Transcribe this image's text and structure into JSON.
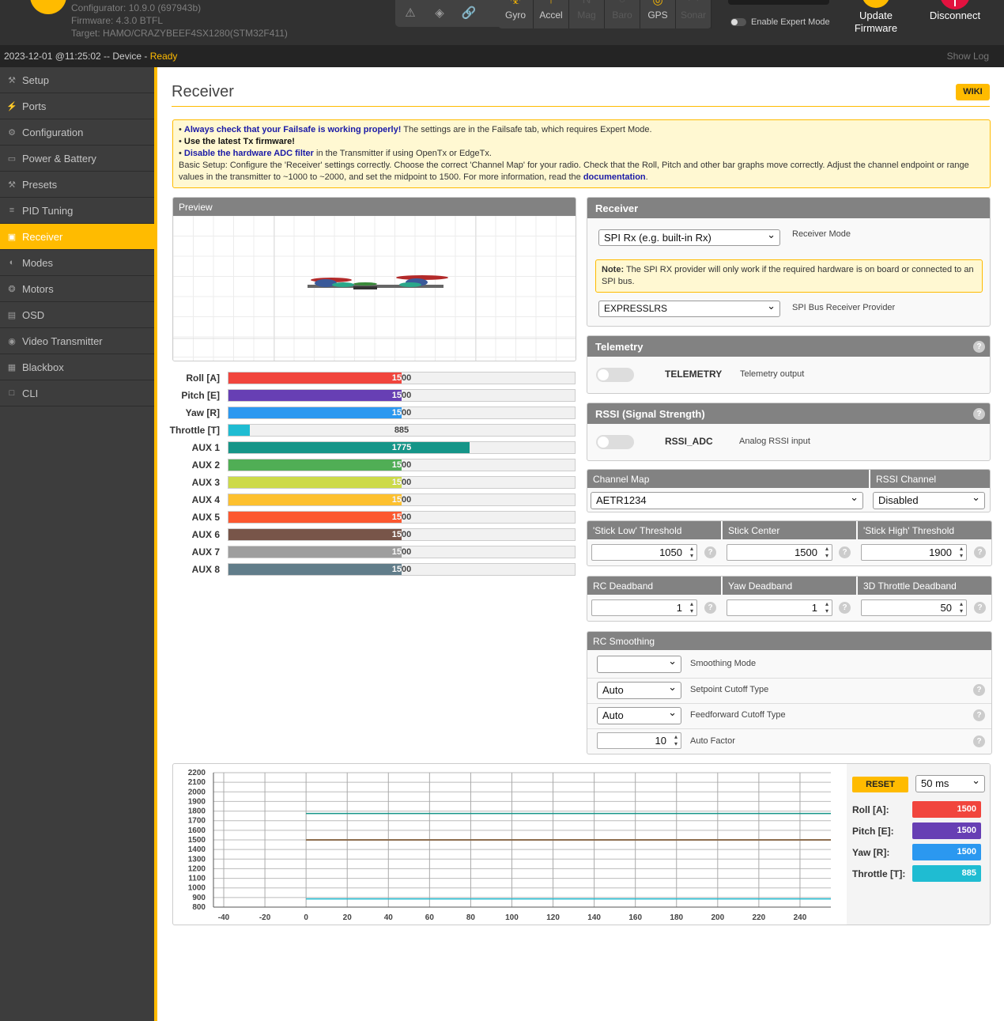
{
  "header": {
    "configurator": "Configurator: 10.9.0 (697943b)",
    "firmware": "Firmware: 4.3.0 BTFL",
    "target": "Target: HAMO/CRAZYBEEF4SX1280(STM32F411)",
    "sensors": [
      {
        "label": "Gyro",
        "icon": "gyro-icon",
        "state": "on"
      },
      {
        "label": "Accel",
        "icon": "accel-icon",
        "state": "on"
      },
      {
        "label": "Mag",
        "icon": "mag-icon",
        "state": "off"
      },
      {
        "label": "Baro",
        "icon": "baro-icon",
        "state": "off"
      },
      {
        "label": "GPS",
        "icon": "gps-icon",
        "state": "on"
      },
      {
        "label": "Sonar",
        "icon": "sonar-icon",
        "state": "off"
      }
    ],
    "expert_mode": "Enable Expert Mode",
    "update_label": "Update",
    "update_label2": "Firmware",
    "disconnect_label": "Disconnect"
  },
  "status": {
    "datetime": "2023-12-01 @11:25:02 -- Device - ",
    "state": "Ready",
    "show_log": "Show Log"
  },
  "sidebar": {
    "items": [
      {
        "label": "Setup",
        "icon": "wrench-icon"
      },
      {
        "label": "Ports",
        "icon": "plug-icon"
      },
      {
        "label": "Configuration",
        "icon": "gear-icon"
      },
      {
        "label": "Power & Battery",
        "icon": "battery-icon"
      },
      {
        "label": "Presets",
        "icon": "presets-icon"
      },
      {
        "label": "PID Tuning",
        "icon": "pid-icon"
      },
      {
        "label": "Receiver",
        "icon": "receiver-icon",
        "active": true
      },
      {
        "label": "Modes",
        "icon": "modes-icon"
      },
      {
        "label": "Motors",
        "icon": "motor-icon"
      },
      {
        "label": "OSD",
        "icon": "osd-icon"
      },
      {
        "label": "Video Transmitter",
        "icon": "antenna-icon"
      },
      {
        "label": "Blackbox",
        "icon": "blackbox-icon"
      },
      {
        "label": "CLI",
        "icon": "cli-icon"
      }
    ]
  },
  "page": {
    "title": "Receiver",
    "wiki": "WIKI"
  },
  "notes": {
    "bullet1_strong": "Always check that your Failsafe is working properly!",
    "bullet1_rest": " The settings are in the Failsafe tab, which requires Expert Mode.",
    "bullet2": "Use the latest Tx firmware!",
    "bullet3_strong": "Disable the hardware ADC filter",
    "bullet3_rest": " in the Transmitter if using OpenTx or EdgeTx.",
    "basic": "Basic Setup: Configure the 'Receiver' settings correctly. Choose the correct 'Channel Map' for your radio. Check that the Roll, Pitch and other bar graphs move correctly. Adjust the channel endpoint or range values in the transmitter to ~1000 to ~2000, and set the midpoint to 1500. For more information, read the ",
    "doc_link": "documentation",
    "end": "."
  },
  "preview": {
    "title": "Preview"
  },
  "channels": [
    {
      "name": "Roll [A]",
      "value": 1500,
      "color": "#f1453d"
    },
    {
      "name": "Pitch [E]",
      "value": 1500,
      "color": "#673fb4"
    },
    {
      "name": "Yaw [R]",
      "value": 1500,
      "color": "#2b98f0"
    },
    {
      "name": "Throttle [T]",
      "value": 885,
      "color": "#1fbcd2"
    },
    {
      "name": "AUX 1",
      "value": 1775,
      "color": "#159588"
    },
    {
      "name": "AUX 2",
      "value": 1500,
      "color": "#50ae55"
    },
    {
      "name": "AUX 3",
      "value": 1500,
      "color": "#cdda49"
    },
    {
      "name": "AUX 4",
      "value": 1500,
      "color": "#fdc02f"
    },
    {
      "name": "AUX 5",
      "value": 1500,
      "color": "#fc5830"
    },
    {
      "name": "AUX 6",
      "value": 1500,
      "color": "#785549"
    },
    {
      "name": "AUX 7",
      "value": 1500,
      "color": "#9e9e9e"
    },
    {
      "name": "AUX 8",
      "value": 1500,
      "color": "#617d8a"
    }
  ],
  "receiver": {
    "title": "Receiver",
    "mode_value": "SPI Rx (e.g. built-in Rx)",
    "mode_label": "Receiver Mode",
    "note_strong": "Note:",
    "note_text": " The SPI RX provider will only work if the required hardware is on board or connected to an SPI bus.",
    "provider_value": "EXPRESSLRS",
    "provider_label": "SPI Bus Receiver Provider"
  },
  "telemetry": {
    "title": "Telemetry",
    "name": "TELEMETRY",
    "desc": "Telemetry output"
  },
  "rssi": {
    "title": "RSSI (Signal Strength)",
    "name": "RSSI_ADC",
    "desc": "Analog RSSI input"
  },
  "channel_map": {
    "title": "Channel Map",
    "value": "AETR1234",
    "rssi_title": "RSSI Channel",
    "rssi_value": "Disabled"
  },
  "thresholds": {
    "low_label": "'Stick Low' Threshold",
    "low": "1050",
    "center_label": "Stick Center",
    "center": "1500",
    "high_label": "'Stick High' Threshold",
    "high": "1900"
  },
  "deadbands": {
    "rc_label": "RC Deadband",
    "rc": "1",
    "yaw_label": "Yaw Deadband",
    "yaw": "1",
    "thr_label": "3D Throttle Deadband",
    "thr": "50"
  },
  "smoothing": {
    "title": "RC Smoothing",
    "mode_value": "",
    "mode_label": "Smoothing Mode",
    "setpoint_value": "Auto",
    "setpoint_label": "Setpoint Cutoff Type",
    "ff_value": "Auto",
    "ff_label": "Feedforward Cutoff Type",
    "auto_factor": "10",
    "auto_label": "Auto Factor"
  },
  "graph": {
    "reset": "RESET",
    "interval": "50 ms",
    "legend": [
      {
        "name": "Roll [A]:",
        "value": "1500",
        "color": "#f1453d"
      },
      {
        "name": "Pitch [E]:",
        "value": "1500",
        "color": "#673fb4"
      },
      {
        "name": "Yaw [R]:",
        "value": "1500",
        "color": "#2b98f0"
      },
      {
        "name": "Throttle [T]:",
        "value": "885",
        "color": "#1fbcd2"
      }
    ]
  },
  "chart_data": {
    "type": "line",
    "y_ticks": [
      2200,
      2100,
      2000,
      1900,
      1800,
      1700,
      1600,
      1500,
      1400,
      1300,
      1200,
      1100,
      1000,
      900,
      800
    ],
    "x_ticks": [
      -40,
      -20,
      0,
      20,
      40,
      60,
      80,
      100,
      120,
      140,
      160,
      180,
      200,
      220,
      240
    ],
    "xlim": [
      -45,
      255
    ],
    "ylim": [
      800,
      2200
    ],
    "series": [
      {
        "value": 1500,
        "color": "#f1453d",
        "x": [
          0,
          255
        ]
      },
      {
        "value": 1500,
        "color": "#673fb4",
        "x": [
          0,
          255
        ]
      },
      {
        "value": 1500,
        "color": "#2b98f0",
        "x": [
          0,
          255
        ]
      },
      {
        "value": 885,
        "color": "#1fbcd2",
        "x": [
          0,
          255
        ]
      },
      {
        "value": 1775,
        "color": "#159588",
        "x": [
          0,
          255
        ]
      },
      {
        "value": 1500,
        "color": "#cdda49",
        "x": [
          0,
          255
        ]
      },
      {
        "value": 1500,
        "color": "#fdc02f",
        "x": [
          0,
          255
        ]
      },
      {
        "value": 1500,
        "color": "#785549",
        "x": [
          0,
          255
        ]
      }
    ]
  }
}
